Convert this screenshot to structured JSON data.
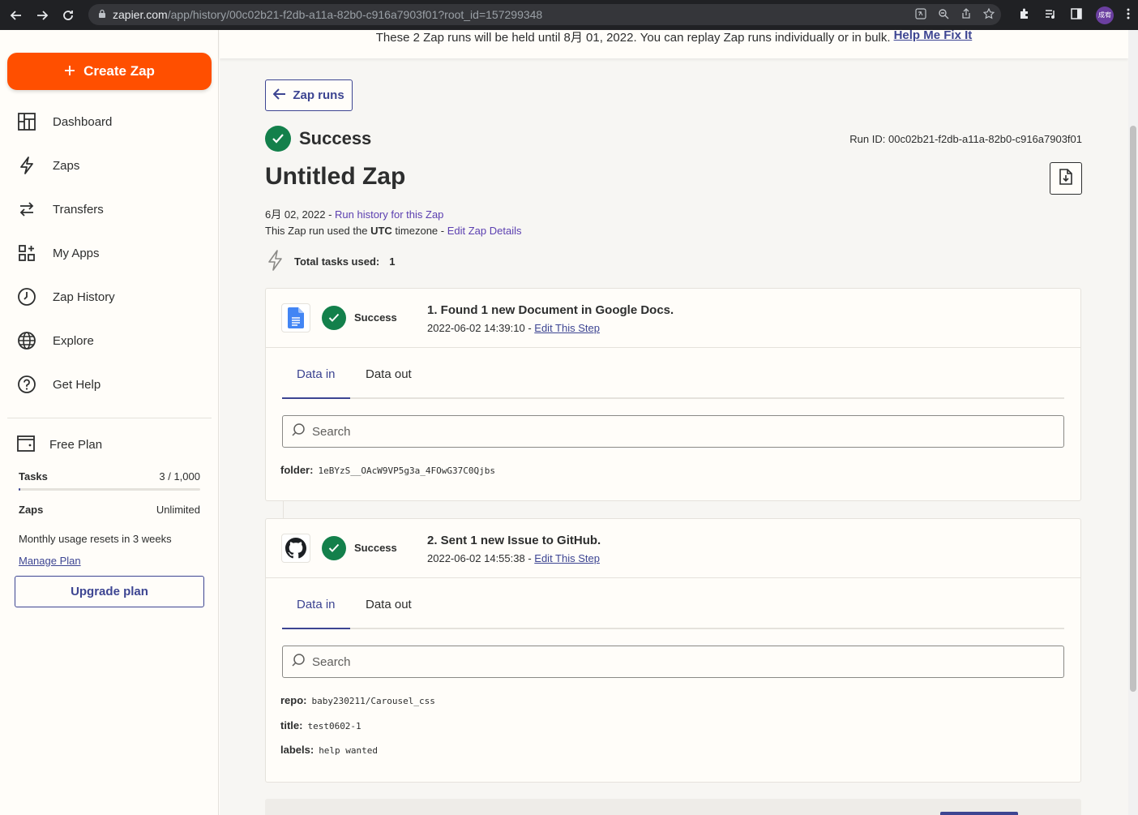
{
  "browser": {
    "url_domain": "zapier.com",
    "url_path": "/app/history/00c02b21-f2db-a11a-82b0-c916a7903f01?root_id=157299348",
    "profile_label": "成宥"
  },
  "banner": {
    "text": "These 2 Zap runs will be held until 8月 01, 2022. You can replay Zap runs individually or in bulk.",
    "link": "Help Me Fix It"
  },
  "sidebar": {
    "create_label": "Create Zap",
    "items": [
      {
        "label": "Dashboard",
        "icon": "dashboard-icon"
      },
      {
        "label": "Zaps",
        "icon": "bolt-icon"
      },
      {
        "label": "Transfers",
        "icon": "transfer-icon"
      },
      {
        "label": "My Apps",
        "icon": "apps-icon"
      },
      {
        "label": "Zap History",
        "icon": "clock-icon"
      },
      {
        "label": "Explore",
        "icon": "globe-icon"
      },
      {
        "label": "Get Help",
        "icon": "help-icon"
      }
    ],
    "plan": {
      "title": "Free Plan",
      "tasks_label": "Tasks",
      "tasks_value": "3 / 1,000",
      "tasks_fraction": 0.003,
      "zaps_label": "Zaps",
      "zaps_value": "Unlimited",
      "reset_text": "Monthly usage resets in 3 weeks",
      "manage_label": "Manage Plan",
      "upgrade_label": "Upgrade plan"
    }
  },
  "main": {
    "back_label": "Zap runs",
    "status": "Success",
    "run_id": "Run ID: 00c02b21-f2db-a11a-82b0-c916a7903f01",
    "zap_title": "Untitled Zap",
    "date": "6月 02, 2022",
    "date_sep": " - ",
    "history_link": "Run history for this Zap",
    "tz_prefix": "This Zap run used the ",
    "tz_name": "UTC",
    "tz_suffix": " timezone - ",
    "edit_details_link": "Edit Zap Details",
    "tasks_used_label": "Total tasks used:",
    "tasks_used_value": "1"
  },
  "steps": [
    {
      "app_icon": "google-docs-icon",
      "status": "Success",
      "title": "1. Found 1 new Document in Google Docs.",
      "time": "2022-06-02 14:39:10 - ",
      "edit_link": "Edit This Step",
      "tab_in": "Data in",
      "tab_out": "Data out",
      "search_placeholder": "Search",
      "fields": [
        {
          "key": "folder:",
          "value": "1eBYzS__OAcW9VP5g3a_4FOwG37C0Qjbs"
        }
      ]
    },
    {
      "app_icon": "github-icon",
      "status": "Success",
      "title": "2. Sent 1 new Issue to GitHub.",
      "time": "2022-06-02 14:55:38 - ",
      "edit_link": "Edit This Step",
      "tab_in": "Data in",
      "tab_out": "Data out",
      "search_placeholder": "Search",
      "fields": [
        {
          "key": "repo:",
          "value": "baby230211/Carousel_css"
        },
        {
          "key": "title:",
          "value": "test0602-1"
        },
        {
          "key": "labels:",
          "value": "help wanted"
        }
      ]
    }
  ],
  "colors": {
    "accent": "#ff4f00",
    "brand": "#3d4592",
    "success": "#13804b"
  }
}
